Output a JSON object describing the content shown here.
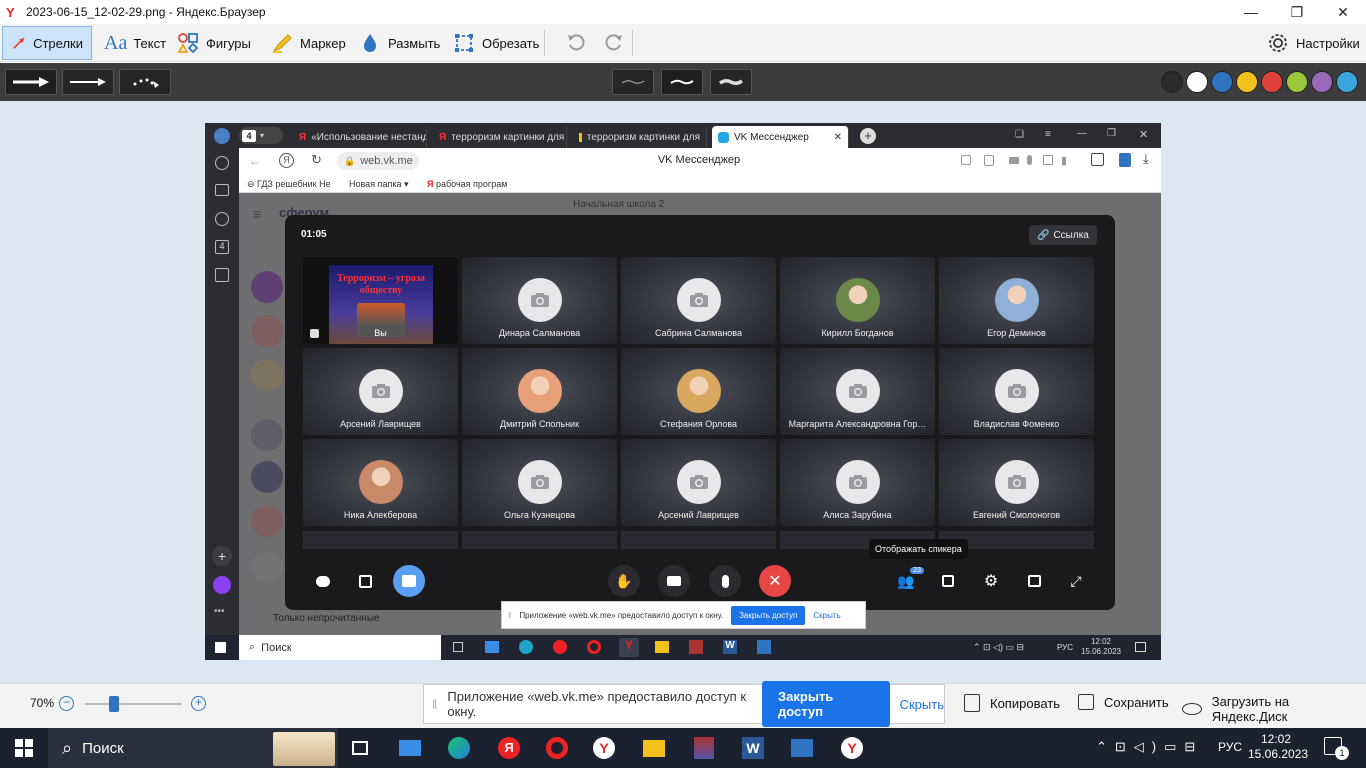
{
  "window": {
    "title": "2023-06-15_12-02-29.png - Яндекс.Браузер",
    "minimize": "—",
    "restore": "❐",
    "close": "✕"
  },
  "toolbar": {
    "arrows": "Стрелки",
    "text": "Текст",
    "shapes": "Фигуры",
    "marker": "Маркер",
    "blur": "Размыть",
    "crop": "Обрезать",
    "settings": "Настройки"
  },
  "palette": [
    "#2b2b2b",
    "#ffffff",
    "#2f74c0",
    "#f2c21b",
    "#e0413b",
    "#9ac73c",
    "#9b69b9",
    "#3aa6dd"
  ],
  "inner_browser": {
    "tab_count": "4",
    "tabs": [
      "«Использование нестанд",
      "терроризм картинки для",
      "терроризм картинки для",
      "VK Мессенджер"
    ],
    "url": "web.vk.me",
    "page_title": "VK Мессенджер",
    "bookmarks": [
      "ГДЗ решебник Не",
      "Новая папка",
      "рабочая програм"
    ],
    "chat_app": "сферум",
    "chat_name": "Начальная школа 2",
    "unread_only": "Только непрочитанные"
  },
  "call": {
    "timer": "01:05",
    "link_button": "Ссылка",
    "screen_share": {
      "title": "Терроризм – угроза обществу",
      "label": "Вы"
    },
    "participants": [
      {
        "name": "Динара Салманова",
        "avatar": "camera"
      },
      {
        "name": "Сабрина Салманова",
        "avatar": "camera"
      },
      {
        "name": "Кирилл Богданов",
        "avatar": "photo"
      },
      {
        "name": "Егор Деминов",
        "avatar": "photo"
      },
      {
        "name": "Арсений Лаврищев",
        "avatar": "camera"
      },
      {
        "name": "Дмитрий Спольник",
        "avatar": "photo"
      },
      {
        "name": "Стефания Орлова",
        "avatar": "photo"
      },
      {
        "name": "Маргарита Александровна Гор…",
        "avatar": "camera"
      },
      {
        "name": "Владислав Фоменко",
        "avatar": "camera"
      },
      {
        "name": "Ника Алекберова",
        "avatar": "photo"
      },
      {
        "name": "Ольга Кузнецова",
        "avatar": "camera"
      },
      {
        "name": "Арсений Лаврищев",
        "avatar": "camera"
      },
      {
        "name": "Алиса Зарубина",
        "avatar": "camera"
      },
      {
        "name": "Евгений Смолоногов",
        "avatar": "camera"
      }
    ],
    "participants_badge": "23",
    "speaker_tooltip": "Отображать спикера",
    "share_notice": {
      "text": "Приложение «web.vk.me» предоставило доступ к окну.",
      "close_access": "Закрыть доступ",
      "hide": "Скрыть"
    }
  },
  "inner_taskbar": {
    "search": "Поиск",
    "lang": "РУС",
    "time": "12:02",
    "date": "15.06.2023"
  },
  "bottom": {
    "zoom": "70%",
    "zoom_level": 0.3,
    "notice_text": "Приложение «web.vk.me» предоставило доступ к окну.",
    "close_access": "Закрыть доступ",
    "hide": "Скрыть",
    "copy": "Копировать",
    "save": "Сохранить",
    "upload": "Загрузить на Яндекс.Диск"
  },
  "taskbar": {
    "search": "Поиск",
    "lang": "РУС",
    "time": "12:02",
    "date": "15.06.2023",
    "notifications": "1"
  }
}
